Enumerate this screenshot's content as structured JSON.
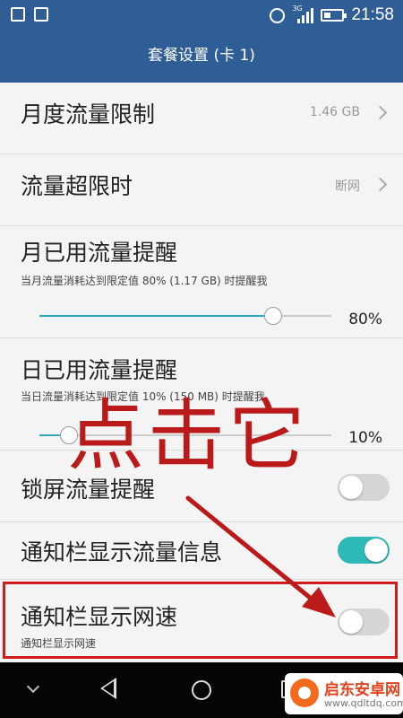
{
  "status_bar": {
    "network_label": "3G",
    "time": "21:58"
  },
  "header": {
    "title": "套餐设置 (卡 1)"
  },
  "settings": {
    "monthly_limit": {
      "label": "月度流量限制",
      "value": "1.46 GB"
    },
    "over_limit": {
      "label": "流量超限时",
      "value": "断网"
    },
    "monthly_reminder": {
      "label": "月已用流量提醒",
      "description": "当月流量消耗达到限定值 80% (1.17 GB) 时提醒我",
      "percent_label": "80%",
      "percent": 80
    },
    "daily_reminder": {
      "label": "日已用流量提醒",
      "description": "当日流量消耗达到限定值 10% (150 MB) 时提醒我",
      "percent_label": "10%",
      "percent": 10
    },
    "lockscreen_reminder": {
      "label": "锁屏流量提醒",
      "enabled": false
    },
    "notification_usage": {
      "label": "通知栏显示流量信息",
      "enabled": true
    },
    "notification_speed": {
      "label": "通知栏显示网速",
      "description": "通知栏显示网速",
      "enabled": false
    }
  },
  "annotation": {
    "text": "点击它",
    "color": "#ba1a1a"
  },
  "nav_bar": {
    "icons": [
      "chevron-down-icon",
      "back-icon",
      "home-icon",
      "recent-apps-icon"
    ]
  },
  "watermark": {
    "title": "启东安卓网",
    "url": "www.qdltdq.com"
  },
  "colors": {
    "header_bg": "#2f5d96",
    "accent": "#2fb8b8",
    "highlight": "#d11a1a"
  }
}
